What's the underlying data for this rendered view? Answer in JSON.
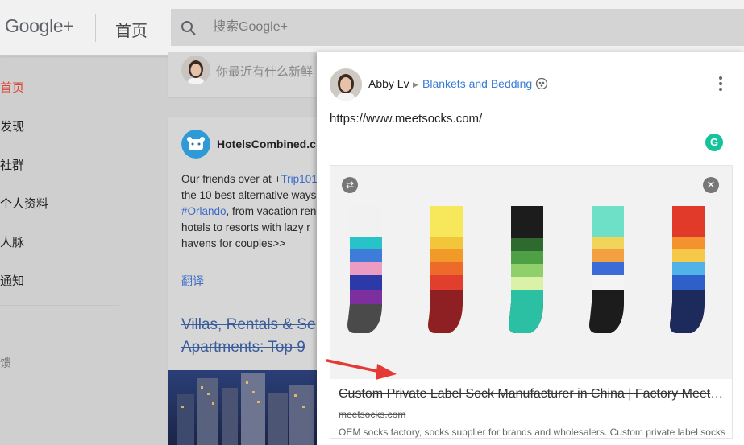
{
  "header": {
    "logo": "Google+",
    "title": "首页",
    "search_placeholder": "搜索Google+"
  },
  "sidebar": {
    "items": [
      {
        "label": "首页",
        "active": true
      },
      {
        "label": "发现"
      },
      {
        "label": "社群"
      },
      {
        "label": "个人资料"
      },
      {
        "label": "人脉"
      },
      {
        "label": "通知"
      }
    ],
    "feedback": "馈"
  },
  "share_box": {
    "placeholder": "你最近有什么新鲜"
  },
  "post": {
    "author": "HotelsCombined.c",
    "text_lines": [
      {
        "pre": "Our friends over at +",
        "link": "Trip101"
      },
      {
        "pre": "the 10 best alternative ways"
      },
      {
        "link": "#Orlando",
        "post": ", from vacation ren"
      },
      {
        "pre": "hotels to resorts with lazy r"
      },
      {
        "pre": "havens for couples>>"
      }
    ],
    "translate": "翻译",
    "link_title_1": "Villas, Rentals & Se",
    "link_title_2": "Apartments: Top 9"
  },
  "dialog": {
    "author": "Abby Lv",
    "collection": "Blankets and Bedding",
    "url_text": "https://www.meetsocks.com/",
    "grammarly": "G",
    "preview": {
      "title": "Custom Private Label Sock Manufacturer in China | Factory Meetsocks",
      "domain": "meetsocks.com",
      "description": "OEM socks factory, socks supplier for brands and wholesalers. Custom private label socks"
    }
  },
  "colors": {
    "accent_red": "#db4437",
    "link_blue": "#3a7bd5",
    "grammarly_green": "#15c39a",
    "arrow_red": "#e53935"
  }
}
